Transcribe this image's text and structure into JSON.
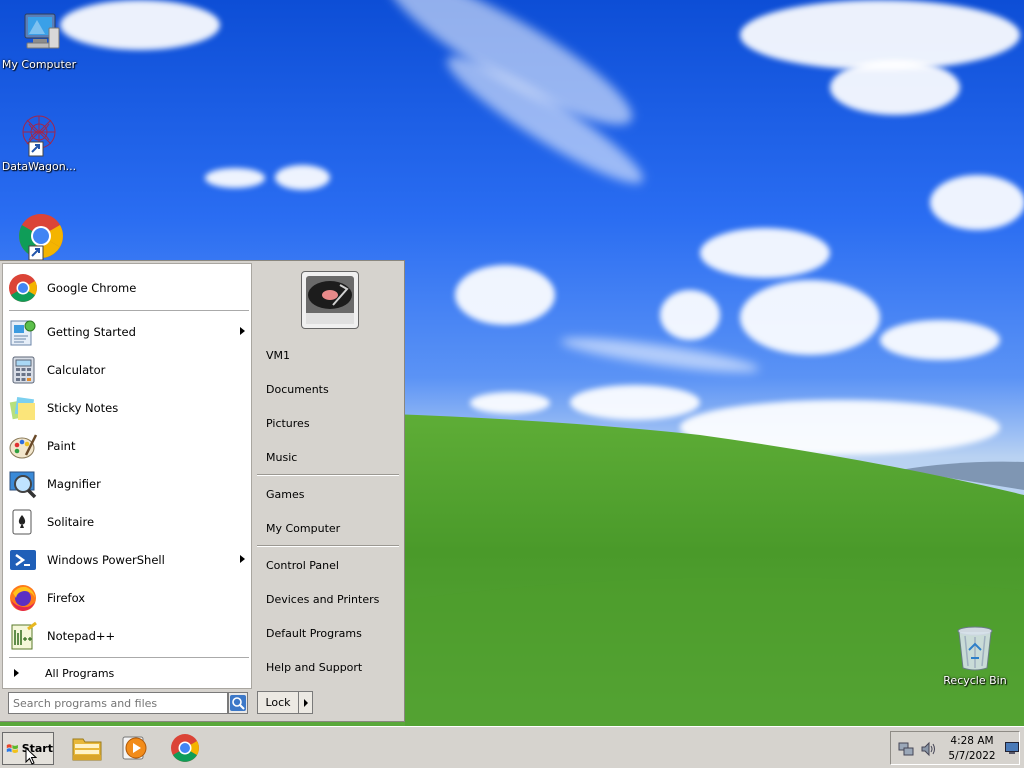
{
  "desktop": {
    "icons": [
      {
        "label": "My Computer",
        "icon": "my-computer-icon"
      },
      {
        "label": "DataWagon...",
        "icon": "datawagon-icon"
      },
      {
        "label": "",
        "icon": "chrome-icon"
      },
      {
        "label": "Recycle Bin",
        "icon": "recycle-bin-icon"
      }
    ]
  },
  "start_menu": {
    "pinned": [
      {
        "label": "Google Chrome",
        "icon": "chrome-icon"
      }
    ],
    "programs": [
      {
        "label": "Getting Started",
        "icon": "getting-started-icon",
        "submenu": true
      },
      {
        "label": "Calculator",
        "icon": "calculator-icon",
        "submenu": false
      },
      {
        "label": "Sticky Notes",
        "icon": "sticky-notes-icon",
        "submenu": false
      },
      {
        "label": "Paint",
        "icon": "paint-icon",
        "submenu": false
      },
      {
        "label": "Magnifier",
        "icon": "magnifier-icon",
        "submenu": false
      },
      {
        "label": "Solitaire",
        "icon": "solitaire-icon",
        "submenu": false
      },
      {
        "label": "Windows PowerShell",
        "icon": "powershell-icon",
        "submenu": true
      },
      {
        "label": "Firefox",
        "icon": "firefox-icon",
        "submenu": false
      },
      {
        "label": "Notepad++",
        "icon": "notepad-plus-plus-icon",
        "submenu": false
      }
    ],
    "all_programs": "All Programs",
    "right_group1": [
      "VM1",
      "Documents",
      "Pictures",
      "Music"
    ],
    "right_group2": [
      "Games",
      "My Computer"
    ],
    "right_group3": [
      "Control Panel",
      "Devices and Printers",
      "Default Programs",
      "Help and Support"
    ],
    "search_placeholder": "Search programs and files",
    "lock_label": "Lock"
  },
  "taskbar": {
    "start_label": "Start",
    "pinned": [
      "file-explorer-icon",
      "media-player-icon",
      "chrome-icon"
    ],
    "clock_time": "4:28 AM",
    "clock_date": "5/7/2022"
  },
  "colors": {
    "sky": "#2a6df2",
    "grass": "#5aa83a",
    "menu_bg": "#d6d3ce"
  }
}
